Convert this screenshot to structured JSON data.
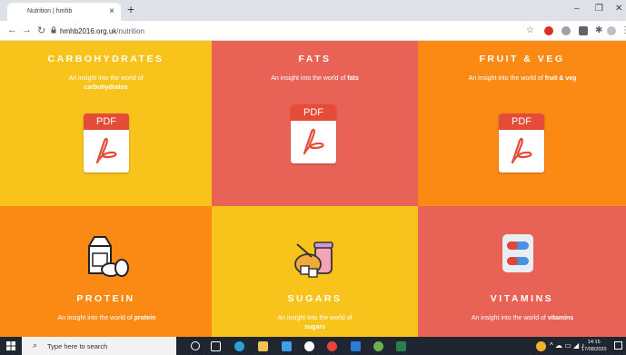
{
  "browser": {
    "tab_title": "Nutrition | hmhb",
    "tab_close": "×",
    "new_tab": "+",
    "minimize": "–",
    "maximize": "❐",
    "close": "✕",
    "url_domain": "hmhb2016.org.uk",
    "url_path": "/nutrition",
    "icons": [
      "back-icon",
      "forward-icon",
      "reload-icon",
      "lock-icon",
      "star-icon",
      "extension-icon",
      "puzzle-icon",
      "profile-icon",
      "menu-icon"
    ]
  },
  "page": {
    "colors": {
      "yellow": "#f8c41b",
      "coral": "#e96256",
      "orange": "#fb8a15"
    },
    "pdf_label": "PDF",
    "cards": [
      {
        "title": "CARBOHYDRATES",
        "desc_pre": "An insight into the world of",
        "desc_bold": "carbohydrates"
      },
      {
        "title": "FATS",
        "desc_pre": "An insight into the world of",
        "desc_bold": "fats"
      },
      {
        "title": "FRUIT & VEG",
        "desc_pre": "An insight into the world of",
        "desc_bold": "fruit & veg"
      },
      {
        "title": "PROTEIN",
        "desc_pre": "An insight into the world of",
        "desc_bold": "protein"
      },
      {
        "title": "SUGARS",
        "desc_pre": "An insight into the world of",
        "desc_bold": "sugars"
      },
      {
        "title": "VITAMINS",
        "desc_pre": "An insight into the world of",
        "desc_bold": "vitamins"
      }
    ]
  },
  "taskbar": {
    "search_placeholder": "Type here to search",
    "time": "14:15",
    "date": "17/08/2020"
  }
}
